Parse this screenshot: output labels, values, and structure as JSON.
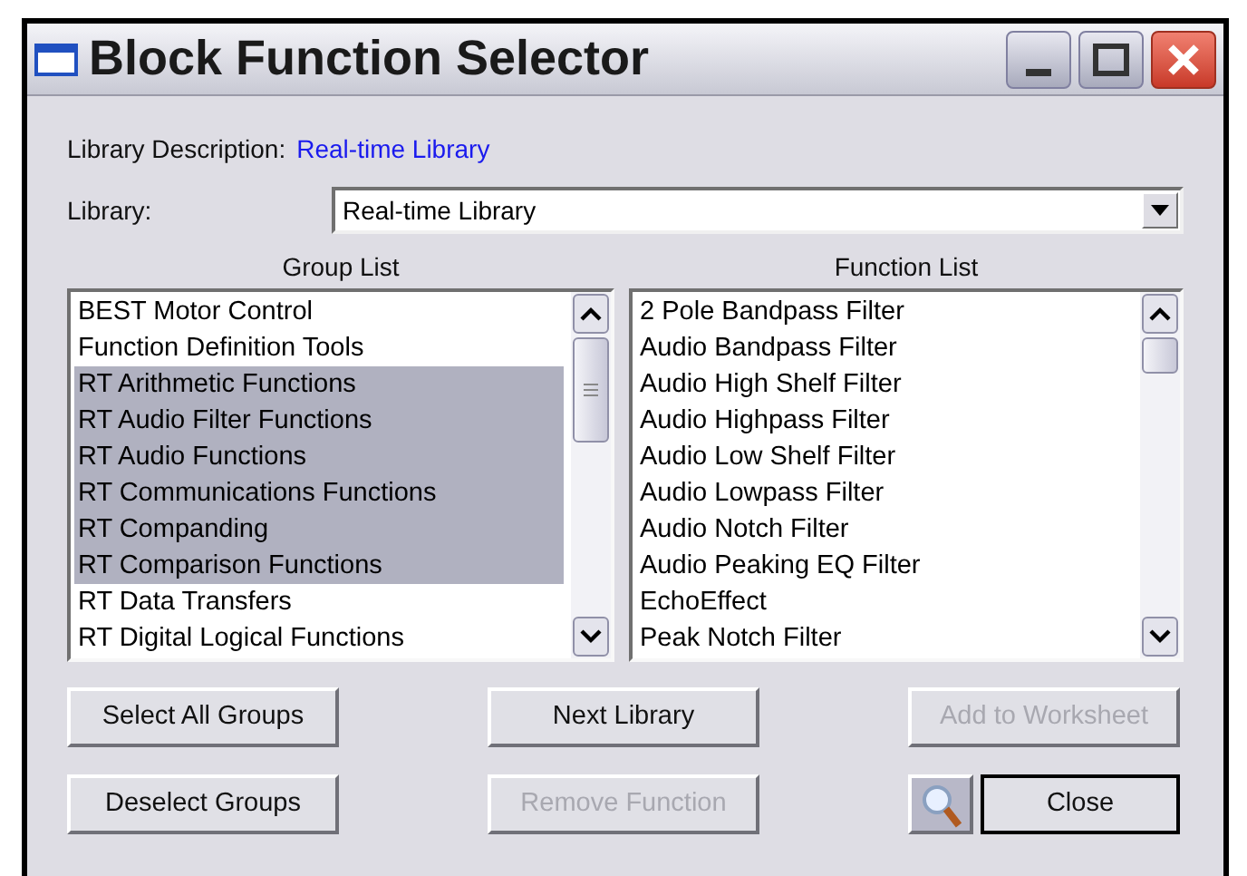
{
  "window": {
    "title": "Block Function Selector"
  },
  "library_description": {
    "label": "Library Description:",
    "value": "Real-time Library"
  },
  "library": {
    "label": "Library:",
    "value": "Real-time Library"
  },
  "group_list": {
    "heading": "Group List",
    "items": [
      {
        "label": "BEST Motor Control",
        "selected": false
      },
      {
        "label": "Function Definition Tools",
        "selected": false
      },
      {
        "label": "RT Arithmetic Functions",
        "selected": true
      },
      {
        "label": "RT Audio Filter Functions",
        "selected": true
      },
      {
        "label": "RT Audio Functions",
        "selected": true
      },
      {
        "label": "RT Communications Functions",
        "selected": true
      },
      {
        "label": "RT Companding",
        "selected": true
      },
      {
        "label": "RT Comparison Functions",
        "selected": true
      },
      {
        "label": "RT Data Transfers",
        "selected": false
      },
      {
        "label": "RT Digital Logical Functions",
        "selected": false
      }
    ]
  },
  "function_list": {
    "heading": "Function List",
    "items": [
      {
        "label": "2 Pole Bandpass Filter",
        "selected": false
      },
      {
        "label": "Audio Bandpass Filter",
        "selected": false
      },
      {
        "label": "Audio High Shelf Filter",
        "selected": false
      },
      {
        "label": "Audio Highpass Filter",
        "selected": false
      },
      {
        "label": "Audio Low Shelf Filter",
        "selected": false
      },
      {
        "label": "Audio Lowpass Filter",
        "selected": false
      },
      {
        "label": "Audio Notch Filter",
        "selected": false
      },
      {
        "label": "Audio Peaking EQ Filter",
        "selected": false
      },
      {
        "label": "EchoEffect",
        "selected": false
      },
      {
        "label": "Peak Notch Filter",
        "selected": false
      }
    ]
  },
  "buttons": [
    {
      "label": "Select All Groups",
      "disabled": false
    },
    {
      "label": "Next Library",
      "disabled": false
    },
    {
      "label": "Add to Worksheet",
      "disabled": true
    },
    {
      "label": "Deselect Groups",
      "disabled": false
    },
    {
      "label": "Remove Function",
      "disabled": true
    },
    {
      "label": "Close",
      "disabled": false
    }
  ]
}
